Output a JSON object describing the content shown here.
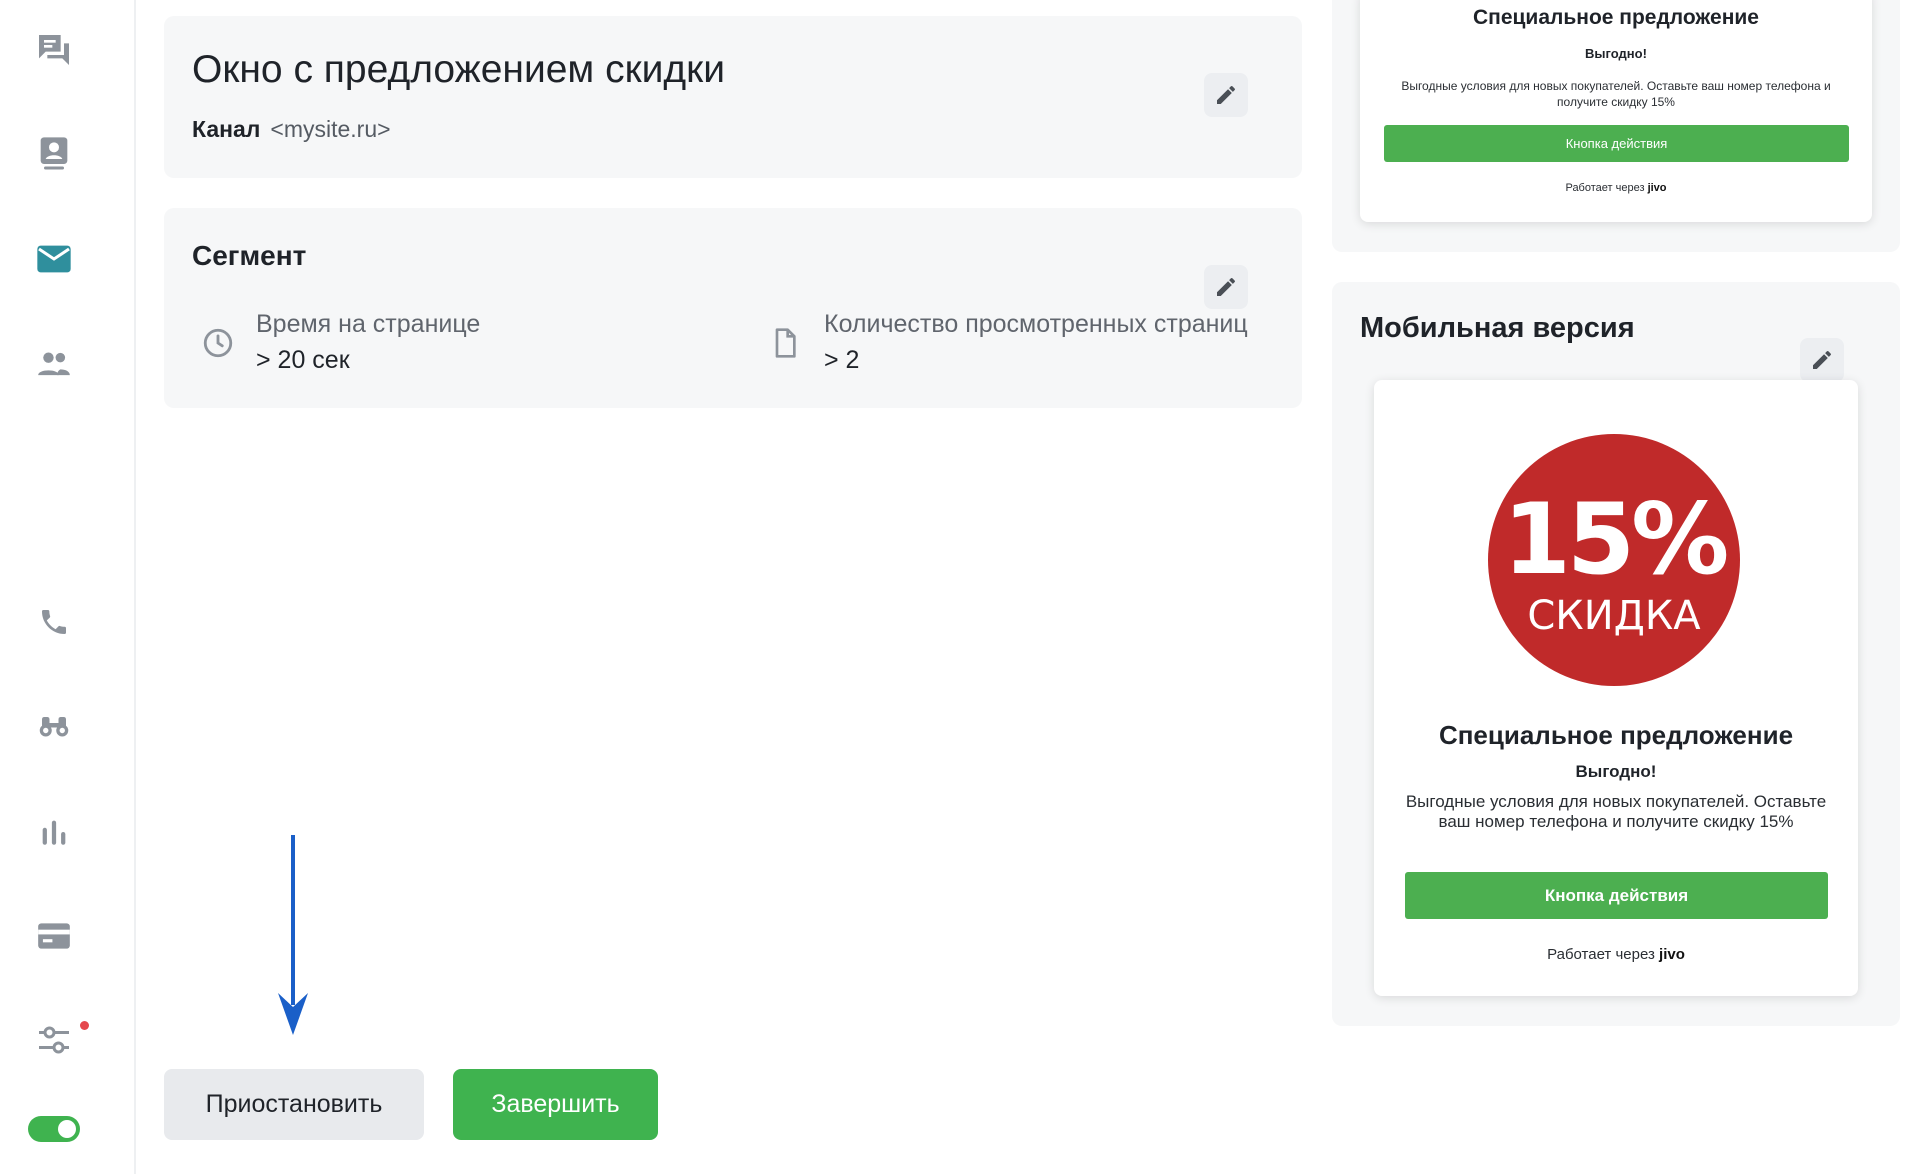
{
  "sidebar": {
    "items": [
      {
        "icon": "chat-icon"
      },
      {
        "icon": "contact-card-icon"
      },
      {
        "icon": "mail-icon",
        "active": true
      },
      {
        "icon": "people-icon"
      },
      {
        "icon": "phone-icon"
      },
      {
        "icon": "binoculars-icon"
      },
      {
        "icon": "bar-chart-icon"
      },
      {
        "icon": "credit-card-icon"
      },
      {
        "icon": "settings-sliders-icon",
        "badge": true
      }
    ],
    "toggle_on": true
  },
  "campaign": {
    "title": "Окно с предложением скидки",
    "channel_label": "Канал",
    "channel_value": "<mysite.ru>"
  },
  "segment": {
    "title": "Сегмент",
    "conditions": [
      {
        "icon": "clock-icon",
        "label": "Время на странице",
        "value": "> 20 сек"
      },
      {
        "icon": "document-icon",
        "label": "Количество просмотренных страниц",
        "value": "> 2"
      }
    ]
  },
  "actions": {
    "pause_label": "Приостановить",
    "finish_label": "Завершить"
  },
  "desktop_preview": {
    "title": "Специальное предложение",
    "subtitle": "Выгодно!",
    "text": "Выгодные условия для новых покупателей. Оставьте ваш номер телефона и получите скидку 15%",
    "action_label": "Кнопка действия",
    "powered_text": "Работает через",
    "powered_brand": "jivo"
  },
  "mobile": {
    "section_title": "Мобильная версия",
    "badge_percent": "15%",
    "badge_word": "СКИДКА",
    "title": "Специальное предложение",
    "subtitle": "Выгодно!",
    "text": "Выгодные условия для новых покупателей. Оставьте ваш номер телефона и получите скидку 15%",
    "action_label": "Кнопка действия",
    "powered_text": "Работает через",
    "powered_brand": "jivo"
  },
  "colors": {
    "accent_green": "#3fb34f",
    "active_icon": "#2f8f9d",
    "arrow_blue": "#1a5fc8",
    "discount_red": "#c02a2a"
  }
}
